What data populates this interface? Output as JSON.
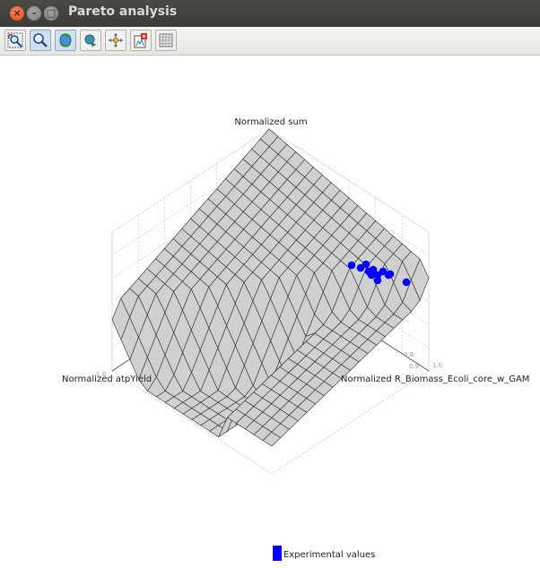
{
  "window": {
    "title": "Pareto analysis"
  },
  "toolbar": {
    "tools": [
      {
        "name": "zoom-region-icon"
      },
      {
        "name": "magnifier-icon"
      },
      {
        "name": "rotate-icon"
      },
      {
        "name": "pan-icon"
      },
      {
        "name": "scale-icon"
      },
      {
        "name": "export-icon"
      },
      {
        "name": "grid-icon"
      }
    ]
  },
  "chart_data": {
    "type": "surface3d",
    "axes": {
      "z": "Normalized sum",
      "x": "Normalized atpYield",
      "y": "Normalized R_Biomass_Ecoli_core_w_GAM"
    },
    "tick_labels": {
      "x_end": "1.0",
      "y_end": "1.0",
      "y_near": "0.8",
      "y_far": "0.9"
    },
    "legend": {
      "label": "Experimental values",
      "color": "#0000ff",
      "position": "bottom-center"
    },
    "surface_color": "#d0d0d0",
    "points_color": "#0000ff"
  }
}
